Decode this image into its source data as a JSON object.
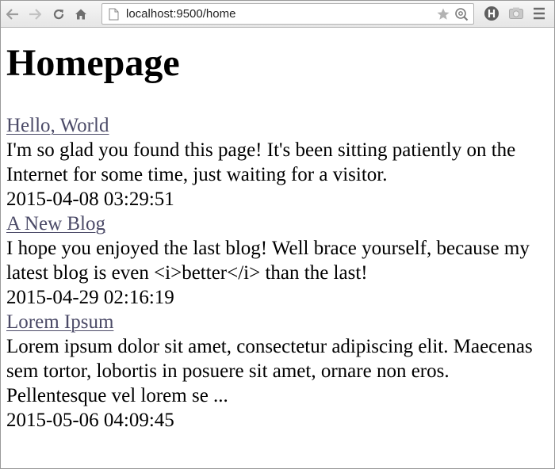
{
  "browser": {
    "url": "localhost:9500/home",
    "icons": {
      "back": "back-arrow-icon",
      "forward": "forward-arrow-icon",
      "reload": "reload-icon",
      "home": "home-icon",
      "page": "page-icon",
      "bookmark": "star-icon",
      "search": "magnifier-icon",
      "extension1": "shield-extension-icon",
      "extension2": "camera-extension-icon",
      "menu": "hamburger-menu-icon"
    }
  },
  "page": {
    "heading": "Homepage",
    "posts": [
      {
        "title": "Hello, World",
        "body": "I'm so glad you found this page! It's been sitting patiently on the Internet for some time, just waiting for a visitor.",
        "date": "2015-04-08 03:29:51"
      },
      {
        "title": "A New Blog",
        "body": "I hope you enjoyed the last blog! Well brace yourself, because my latest blog is even <i>better</i> than the last!",
        "date": "2015-04-29 02:16:19"
      },
      {
        "title": "Lorem Ipsum",
        "body": "Lorem ipsum dolor sit amet, consectetur adipiscing elit. Maecenas sem tortor, lobortis in posuere sit amet, ornare non eros. Pellentesque vel lorem se ...",
        "date": "2015-05-06 04:09:45"
      }
    ]
  }
}
